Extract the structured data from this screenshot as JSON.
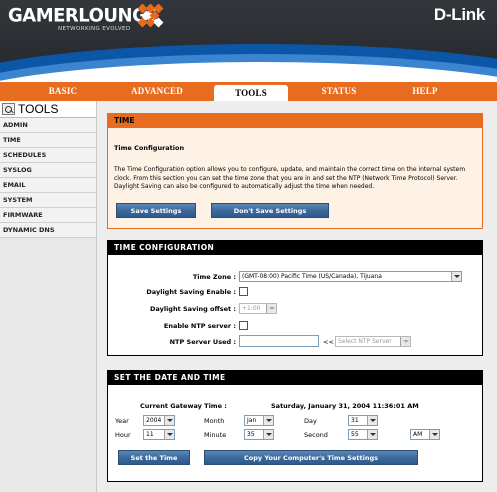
{
  "header": {
    "logo": "GAMERLOUNGE",
    "logo_tagline": "NETWORKING EVOLVED",
    "brand": "D-Link"
  },
  "nav": {
    "tabs": [
      "BASIC",
      "ADVANCED",
      "TOOLS",
      "STATUS",
      "HELP"
    ],
    "active": "TOOLS"
  },
  "sidebar": {
    "title": "TOOLS",
    "items": [
      "ADMIN",
      "TIME",
      "SCHEDULES",
      "SYSLOG",
      "EMAIL",
      "SYSTEM",
      "FIRMWARE",
      "DYNAMIC DNS"
    ]
  },
  "time_panel": {
    "title": "TIME",
    "heading": "Time Configuration",
    "description": "The Time Configuration option allows you to configure, update, and maintain the correct time on the internal system clock. From this section you can set the time zone that you are in and set the NTP (Network Time Protocol) Server. Daylight Saving can also be configured to automatically adjust the time when needed.",
    "save_label": "Save Settings",
    "dont_save_label": "Don't Save Settings"
  },
  "time_config": {
    "title": "TIME CONFIGURATION",
    "time_zone_label": "Time Zone :",
    "time_zone_value": "(GMT-08:00) Pacific Time (US/Canada), Tijuana",
    "dst_enable_label": "Daylight Saving Enable :",
    "dst_offset_label": "Daylight Saving offset :",
    "dst_offset_value": "+1:00",
    "ntp_enable_label": "Enable NTP server :",
    "ntp_used_label": "NTP Server Used :",
    "ntp_arrow": "<<",
    "ntp_select_value": "Select NTP Server"
  },
  "date_time": {
    "title": "SET THE DATE AND TIME",
    "gateway_label": "Current Gateway Time :",
    "gateway_value": "Saturday, January 31, 2004 11:36:01 AM",
    "year_label": "Year",
    "year_value": "2004",
    "month_label": "Month",
    "month_value": "Jan",
    "day_label": "Day",
    "day_value": "31",
    "hour_label": "Hour",
    "hour_value": "11",
    "minute_label": "Minute",
    "minute_value": "35",
    "second_label": "Second",
    "second_value": "55",
    "ampm_value": "AM",
    "set_time_label": "Set the Time",
    "copy_time_label": "Copy Your Computer's Time Settings"
  },
  "colors": {
    "accent_orange": "#e76c1f",
    "button_blue": "#3c6a9c",
    "header_dark": "#2a2d31"
  }
}
